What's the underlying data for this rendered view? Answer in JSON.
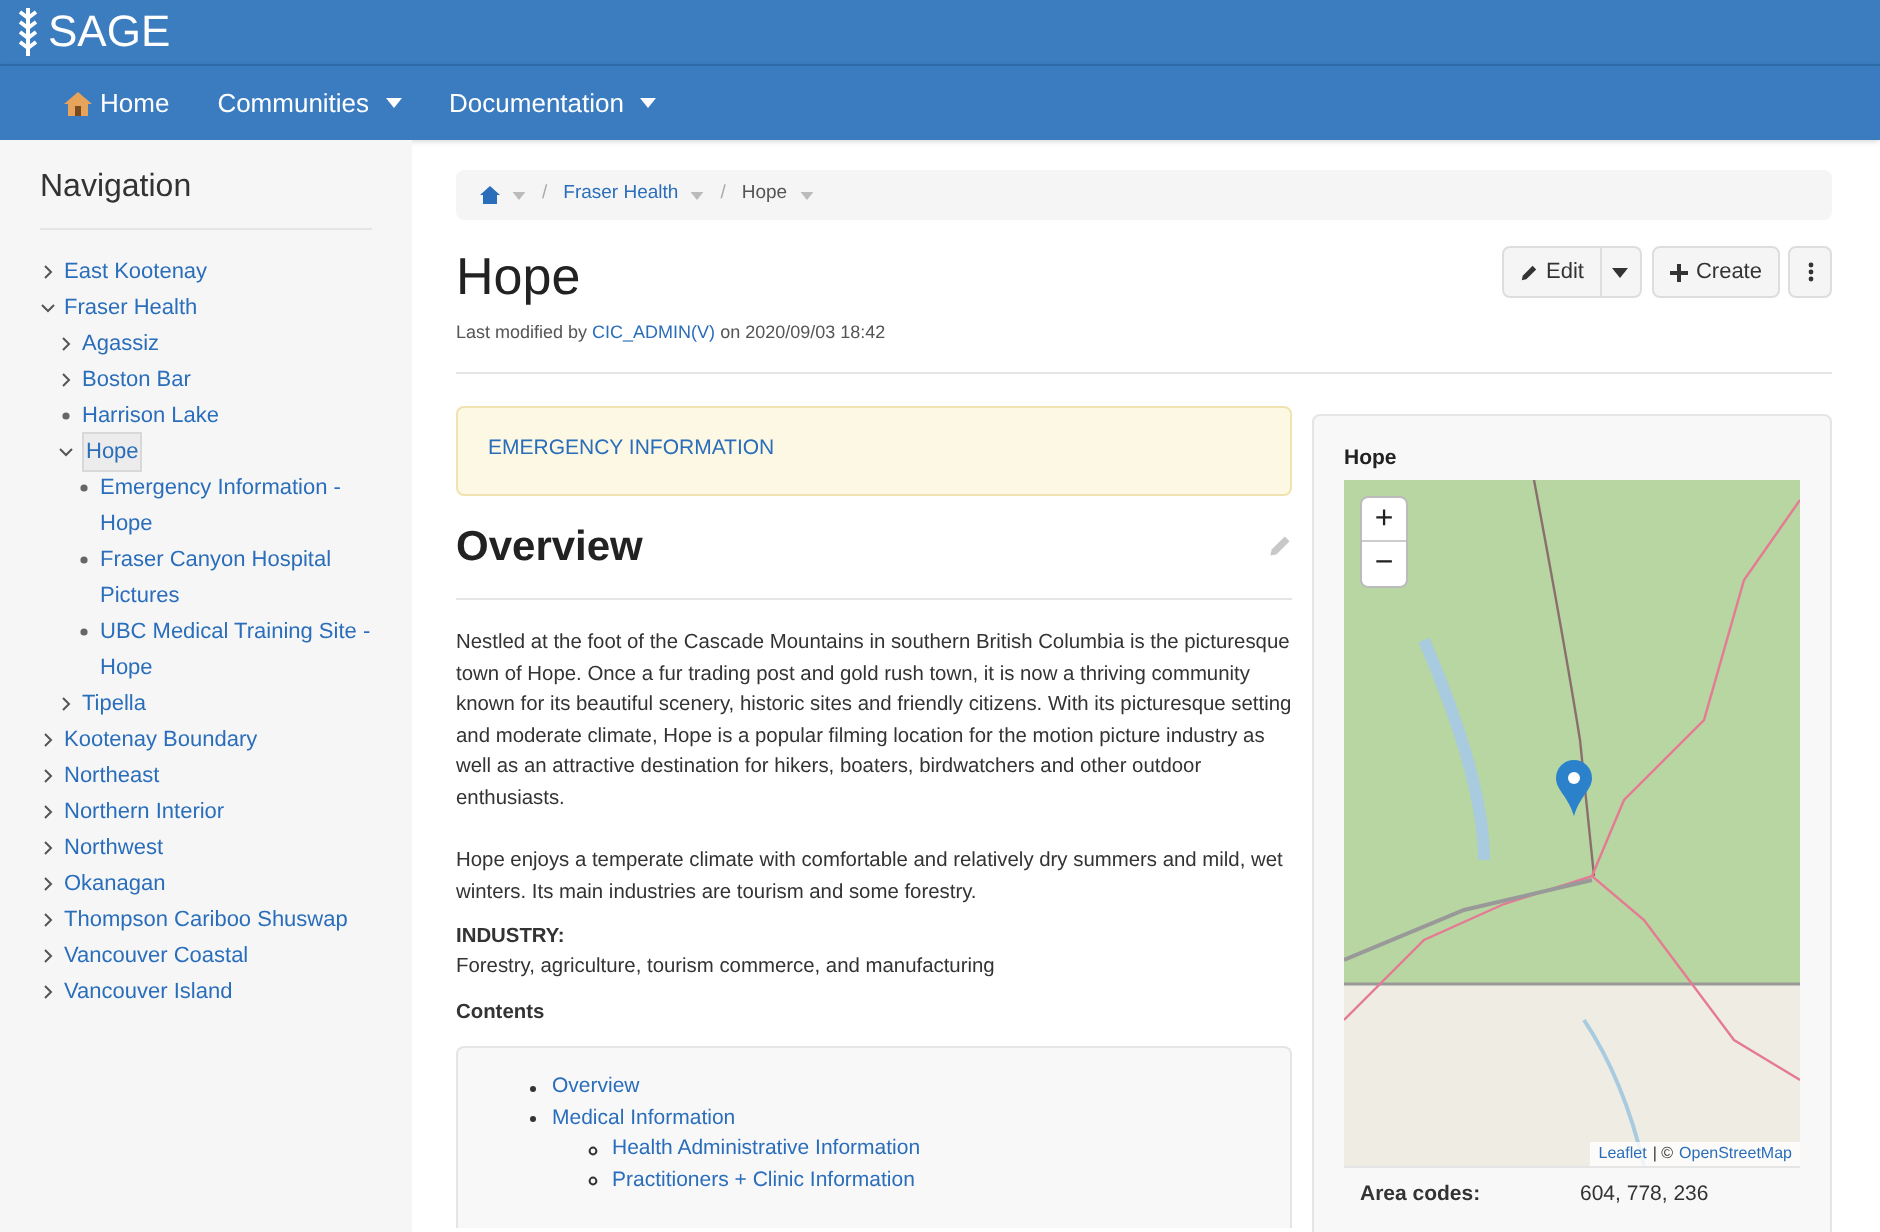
{
  "header": {
    "logo_text": "SAGE"
  },
  "navbar": [
    {
      "label": "Home",
      "kind": "home"
    },
    {
      "label": "Communities",
      "kind": "dropdown"
    },
    {
      "label": "Documentation",
      "kind": "dropdown"
    }
  ],
  "sidebar": {
    "title": "Navigation",
    "items": [
      {
        "label": "East Kootenay",
        "kind": "branch",
        "expanded": false,
        "selected": false
      },
      {
        "label": "Fraser Health",
        "kind": "branch",
        "expanded": true,
        "selected": false,
        "children": [
          {
            "label": "Agassiz",
            "kind": "branch",
            "expanded": false,
            "selected": false
          },
          {
            "label": "Boston Bar",
            "kind": "branch",
            "expanded": false,
            "selected": false
          },
          {
            "label": "Harrison Lake",
            "kind": "leaf",
            "selected": false
          },
          {
            "label": "Hope",
            "kind": "branch",
            "expanded": true,
            "selected": true,
            "children": [
              {
                "label": "Emergency Information - Hope",
                "kind": "leaf",
                "selected": false
              },
              {
                "label": "Fraser Canyon Hospital Pictures",
                "kind": "leaf",
                "selected": false
              },
              {
                "label": "UBC Medical Training Site - Hope",
                "kind": "leaf",
                "selected": false
              }
            ]
          },
          {
            "label": "Tipella",
            "kind": "branch",
            "expanded": false,
            "selected": false
          }
        ]
      },
      {
        "label": "Kootenay Boundary",
        "kind": "branch",
        "expanded": false,
        "selected": false
      },
      {
        "label": "Northeast",
        "kind": "branch",
        "expanded": false,
        "selected": false
      },
      {
        "label": "Northern Interior",
        "kind": "branch",
        "expanded": false,
        "selected": false
      },
      {
        "label": "Northwest",
        "kind": "branch",
        "expanded": false,
        "selected": false
      },
      {
        "label": "Okanagan",
        "kind": "branch",
        "expanded": false,
        "selected": false
      },
      {
        "label": "Thompson Cariboo Shuswap",
        "kind": "branch",
        "expanded": false,
        "selected": false
      },
      {
        "label": "Vancouver Coastal",
        "kind": "branch",
        "expanded": false,
        "selected": false
      },
      {
        "label": "Vancouver Island",
        "kind": "branch",
        "expanded": false,
        "selected": false
      }
    ]
  },
  "breadcrumb": [
    {
      "kind": "home"
    },
    {
      "separator": "/",
      "label": "Fraser Health",
      "kind": "link"
    },
    {
      "separator": "/",
      "label": "Hope",
      "kind": "current"
    }
  ],
  "page": {
    "title": "Hope",
    "modified_prefix": "Last modified by",
    "modified_user": "CIC_ADMIN(V)",
    "modified_suffix": "on 2020/09/03 18:42",
    "buttons": [
      {
        "label": "Edit",
        "kind": "edit"
      },
      {
        "kind": "caret"
      },
      {
        "label": "Create",
        "kind": "create"
      },
      {
        "kind": "more"
      }
    ]
  },
  "alert": {
    "text": "EMERGENCY INFORMATION"
  },
  "section_title": "Overview",
  "paragraphs": [
    "Nestled at the foot of the Cascade Mountains in southern British Columbia is the picturesque town of Hope. Once a fur trading post and gold rush town, it is now a thriving community known for its beautiful scenery, historic sites and friendly citizens. With its picturesque setting and moderate climate, Hope is a popular filming location for the motion picture industry as well as an attractive destination for hikers, boaters, birdwatchers and other outdoor enthusiasts.",
    "Hope enjoys a temperate climate with comfortable and relatively dry summers and mild, wet winters. Its main industries are tourism and some forestry."
  ],
  "industry": {
    "label": "INDUSTRY:",
    "text": "Forestry, agriculture, tourism commerce, and manufacturing"
  },
  "contents": {
    "title": "Contents",
    "items": [
      {
        "label": "Overview"
      },
      {
        "label": "Medical Information",
        "children": [
          {
            "label": "Health Administrative Information"
          },
          {
            "label": "Practitioners + Clinic Information"
          }
        ]
      }
    ]
  },
  "infobox": {
    "title": "Hope",
    "zoom_in": "+",
    "zoom_out": "−",
    "attribution_leaflet": "Leaflet",
    "attribution_sep": "| ©",
    "attribution_osm": "OpenStreetMap",
    "rows": [
      {
        "label": "Area codes:",
        "value": "604, 778, 236"
      }
    ]
  }
}
